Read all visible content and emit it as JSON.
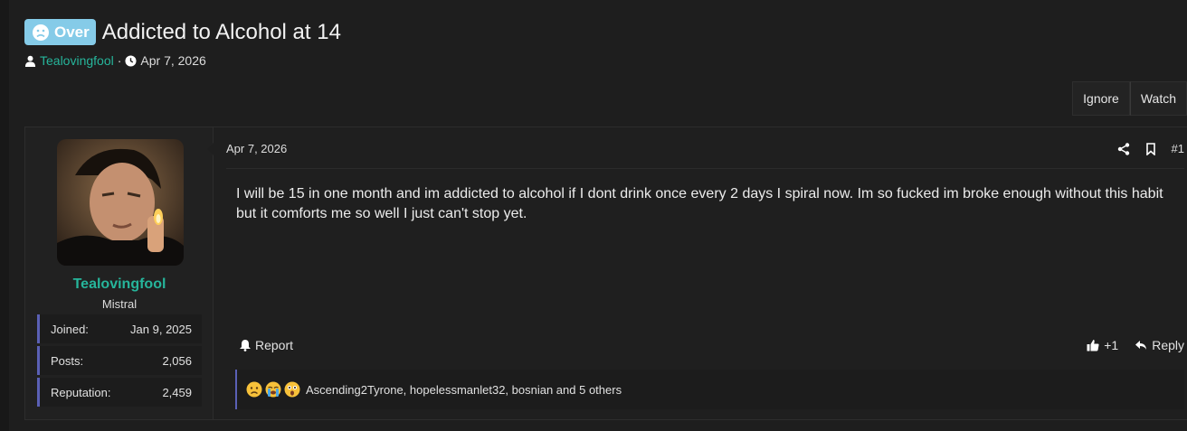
{
  "thread": {
    "prefix_label": "Over",
    "prefix_icon": "frown-face-icon",
    "title": "Addicted to Alcohol at 14",
    "author": "Tealovingfool",
    "separator": "·",
    "date": "Apr 7, 2026"
  },
  "actions": {
    "ignore": "Ignore",
    "watch": "Watch"
  },
  "post": {
    "date": "Apr 7, 2026",
    "number": "#1",
    "message": "I will be 15 in one month and im addicted to alcohol if I dont drink once every 2 days I spiral now. Im so fucked im broke enough without this habit but it comforts me so well I just can't stop yet.",
    "report_label": "Report",
    "like_count": "+1",
    "reply_label": "Reply"
  },
  "user": {
    "name": "Tealovingfool",
    "title": "Mistral",
    "stats": [
      {
        "label": "Joined:",
        "value": "Jan 9, 2025"
      },
      {
        "label": "Posts:",
        "value": "2,056"
      },
      {
        "label": "Reputation:",
        "value": "2,459"
      }
    ]
  },
  "reactions": {
    "icons": [
      "sad-face-icon",
      "crying-face-icon",
      "shocked-face-icon"
    ],
    "text": "Ascending2Tyrone, hopelessmanlet32, bosnian and 5 others"
  },
  "colors": {
    "accent": "#26b59b",
    "prefix_bg": "#85cbe8",
    "stat_border": "#5a60b5"
  }
}
